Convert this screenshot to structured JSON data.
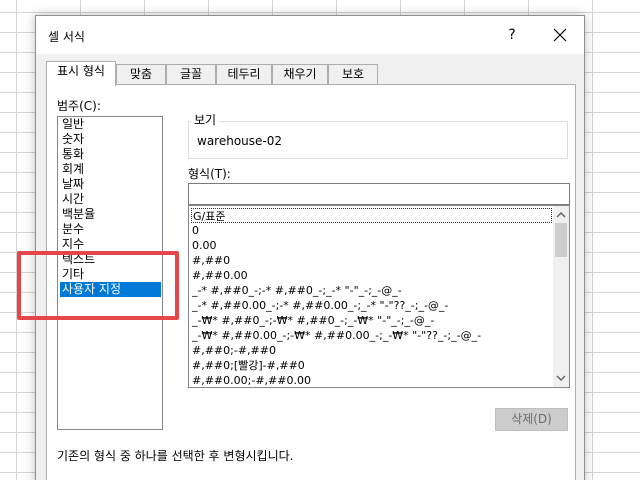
{
  "dialog": {
    "title": "셀 서식",
    "help_label": "?",
    "tabs": [
      {
        "label": "표시 형식",
        "active": true
      },
      {
        "label": "맞춤"
      },
      {
        "label": "글꼴"
      },
      {
        "label": "테두리"
      },
      {
        "label": "채우기"
      },
      {
        "label": "보호"
      }
    ]
  },
  "category": {
    "label": "범주(C):",
    "items": [
      "일반",
      "숫자",
      "통화",
      "회계",
      "날짜",
      "시간",
      "백분율",
      "분수",
      "지수",
      "텍스트",
      "기타",
      "사용자 지정"
    ],
    "selected": "사용자 지정"
  },
  "preview": {
    "label": "보기",
    "value": "warehouse-02"
  },
  "format": {
    "label": "형식(T):",
    "value": "",
    "items": [
      "G/표준",
      "0",
      "0.00",
      "#,##0",
      "#,##0.00",
      "_-* #,##0_-;-* #,##0_-;_-* \"-\"_-;_-@_-",
      "_-* #,##0.00_-;-* #,##0.00_-;_-* \"-\"??_-;_-@_-",
      "_-₩* #,##0_-;-₩* #,##0_-;_-₩* \"-\"_-;_-@_-",
      "_-₩* #,##0.00_-;-₩* #,##0.00_-;_-₩* \"-\"??_-;_-@_-",
      "#,##0;-#,##0",
      "#,##0;[빨강]-#,##0",
      "#,##0.00;-#,##0.00"
    ],
    "selected": "G/표준"
  },
  "delete_button": "삭제(D)",
  "description": "기존의 형식 중 하나를 선택한 후 변형시킵니다.",
  "colors": {
    "selection": "#0078d7",
    "highlight_box": "#e6454a"
  }
}
